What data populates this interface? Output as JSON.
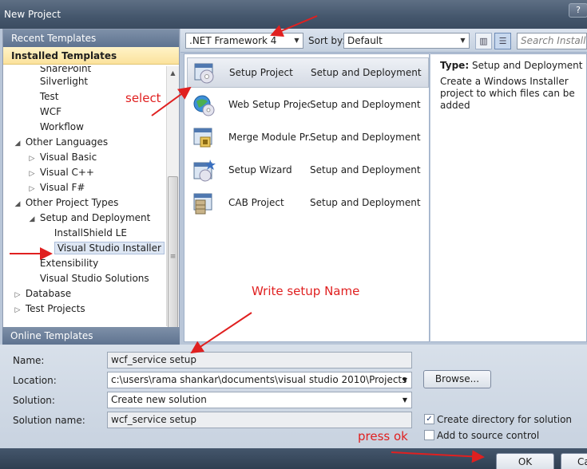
{
  "window": {
    "title": "New Project",
    "help_label": "?"
  },
  "left": {
    "recent_header": "Recent Templates",
    "installed_header": "Installed Templates",
    "online_header": "Online Templates",
    "tree": [
      {
        "label": "SharePoint",
        "indent": 2,
        "toggle": "",
        "cut": true
      },
      {
        "label": "Silverlight",
        "indent": 2,
        "toggle": ""
      },
      {
        "label": "Test",
        "indent": 2,
        "toggle": ""
      },
      {
        "label": "WCF",
        "indent": 2,
        "toggle": ""
      },
      {
        "label": "Workflow",
        "indent": 2,
        "toggle": ""
      },
      {
        "label": "Other Languages",
        "indent": 1,
        "toggle": "expanded"
      },
      {
        "label": "Visual Basic",
        "indent": 2,
        "toggle": "collapsed"
      },
      {
        "label": "Visual C++",
        "indent": 2,
        "toggle": "collapsed"
      },
      {
        "label": "Visual F#",
        "indent": 2,
        "toggle": "collapsed"
      },
      {
        "label": "Other Project Types",
        "indent": 1,
        "toggle": "expanded"
      },
      {
        "label": "Setup and Deployment",
        "indent": 2,
        "toggle": "expanded"
      },
      {
        "label": "InstallShield LE",
        "indent": 3,
        "toggle": ""
      },
      {
        "label": "Visual Studio Installer",
        "indent": 3,
        "toggle": "",
        "selected": true
      },
      {
        "label": "Extensibility",
        "indent": 2,
        "toggle": ""
      },
      {
        "label": "Visual Studio Solutions",
        "indent": 2,
        "toggle": ""
      },
      {
        "label": "Database",
        "indent": 1,
        "toggle": "collapsed"
      },
      {
        "label": "Test Projects",
        "indent": 1,
        "toggle": "collapsed"
      }
    ]
  },
  "toolbar": {
    "framework": ".NET Framework 4",
    "sort_label": "Sort by:",
    "sort_value": "Default",
    "search_placeholder": "Search Installed Te"
  },
  "templates": [
    {
      "name": "Setup Project",
      "type": "Setup and Deployment",
      "icon": "setup-project-icon",
      "selected": true
    },
    {
      "name": "Web Setup Project",
      "type": "Setup and Deployment",
      "icon": "web-setup-project-icon"
    },
    {
      "name": "Merge Module Pr...",
      "type": "Setup and Deployment",
      "icon": "merge-module-project-icon"
    },
    {
      "name": "Setup Wizard",
      "type": "Setup and Deployment",
      "icon": "setup-wizard-icon"
    },
    {
      "name": "CAB Project",
      "type": "Setup and Deployment",
      "icon": "cab-project-icon"
    }
  ],
  "details": {
    "type_label": "Type:",
    "type_value": "Setup and Deployment",
    "description": "Create a Windows Installer project to which files can be added"
  },
  "form": {
    "name_label": "Name:",
    "name_value": "wcf_service setup",
    "location_label": "Location:",
    "location_value": "c:\\users\\rama shankar\\documents\\visual studio 2010\\Projects",
    "solution_label": "Solution:",
    "solution_value": "Create new solution",
    "solution_name_label": "Solution name:",
    "solution_name_value": "wcf_service setup",
    "browse_label": "Browse...",
    "create_dir_label": "Create directory for solution",
    "create_dir_checked": true,
    "source_control_label": "Add to source control",
    "source_control_checked": false,
    "ok_label": "OK",
    "cancel_label": "Ca"
  },
  "annotations": {
    "select": "select",
    "write_name": "Write setup Name",
    "press_ok": "press ok",
    "color": "#e02020"
  }
}
